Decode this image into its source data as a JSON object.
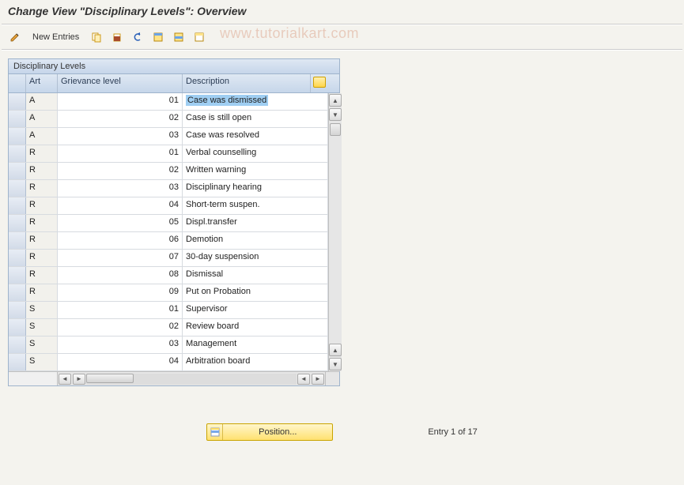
{
  "title": "Change View \"Disciplinary Levels\": Overview",
  "watermark": "www.tutorialkart.com",
  "toolbar": {
    "new_entries": "New Entries"
  },
  "panel": {
    "title": "Disciplinary Levels",
    "columns": {
      "art": "Art",
      "grievance_level": "Grievance level",
      "description": "Description"
    },
    "rows": [
      {
        "art": "A",
        "level": "01",
        "desc": "Case was dismissed",
        "selected": true
      },
      {
        "art": "A",
        "level": "02",
        "desc": "Case is still open"
      },
      {
        "art": "A",
        "level": "03",
        "desc": "Case was resolved"
      },
      {
        "art": "R",
        "level": "01",
        "desc": "Verbal counselling"
      },
      {
        "art": "R",
        "level": "02",
        "desc": "Written warning"
      },
      {
        "art": "R",
        "level": "03",
        "desc": "Disciplinary hearing"
      },
      {
        "art": "R",
        "level": "04",
        "desc": "Short-term suspen."
      },
      {
        "art": "R",
        "level": "05",
        "desc": "Displ.transfer"
      },
      {
        "art": "R",
        "level": "06",
        "desc": "Demotion"
      },
      {
        "art": "R",
        "level": "07",
        "desc": "30-day suspension"
      },
      {
        "art": "R",
        "level": "08",
        "desc": "Dismissal"
      },
      {
        "art": "R",
        "level": "09",
        "desc": "Put on Probation"
      },
      {
        "art": "S",
        "level": "01",
        "desc": "Supervisor"
      },
      {
        "art": "S",
        "level": "02",
        "desc": "Review board"
      },
      {
        "art": "S",
        "level": "03",
        "desc": "Management"
      },
      {
        "art": "S",
        "level": "04",
        "desc": "Arbitration board"
      }
    ]
  },
  "footer": {
    "position_label": "Position...",
    "entry_text": "Entry 1 of 17"
  }
}
